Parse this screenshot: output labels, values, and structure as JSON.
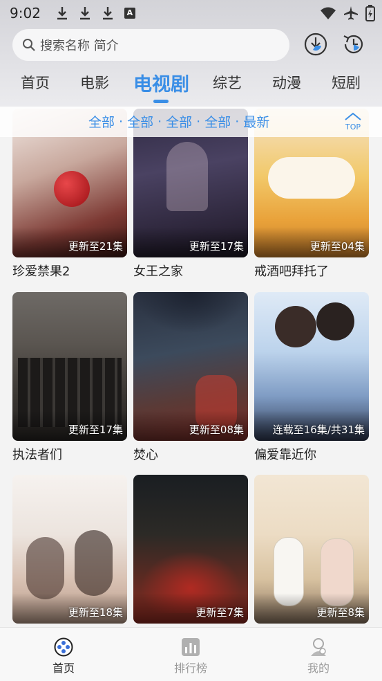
{
  "status_bar": {
    "time": "9:02",
    "badge_letter": "A"
  },
  "search": {
    "placeholder": "搜索名称 简介"
  },
  "category_tabs": [
    {
      "label": "首页",
      "active": false
    },
    {
      "label": "电影",
      "active": false
    },
    {
      "label": "电视剧",
      "active": true
    },
    {
      "label": "综艺",
      "active": false
    },
    {
      "label": "动漫",
      "active": false
    },
    {
      "label": "短剧",
      "active": false
    }
  ],
  "filter": {
    "items": [
      "全部",
      "全部",
      "全部",
      "全部",
      "最新"
    ],
    "top_label": "TOP"
  },
  "shows": [
    {
      "title": "珍爱禁果2",
      "badge": "更新至21集"
    },
    {
      "title": "女王之家",
      "badge": "更新至17集"
    },
    {
      "title": "戒酒吧拜托了",
      "badge": "更新至04集"
    },
    {
      "title": "执法者们",
      "badge": "更新至17集"
    },
    {
      "title": "焚心",
      "badge": "更新至08集"
    },
    {
      "title": "偏爱靠近你",
      "badge": "连载至16集/共31集"
    },
    {
      "title": "",
      "badge": "更新至18集"
    },
    {
      "title": "",
      "badge": "更新至7集"
    },
    {
      "title": "",
      "badge": "更新至8集"
    }
  ],
  "bottom_nav": [
    {
      "label": "首页",
      "icon": "film-reel-icon",
      "active": true
    },
    {
      "label": "排行榜",
      "icon": "chart-bar-icon",
      "active": false
    },
    {
      "label": "我的",
      "icon": "user-icon",
      "active": false
    }
  ],
  "colors": {
    "accent": "#3a8ee6",
    "inactive": "#9a9a9a"
  }
}
